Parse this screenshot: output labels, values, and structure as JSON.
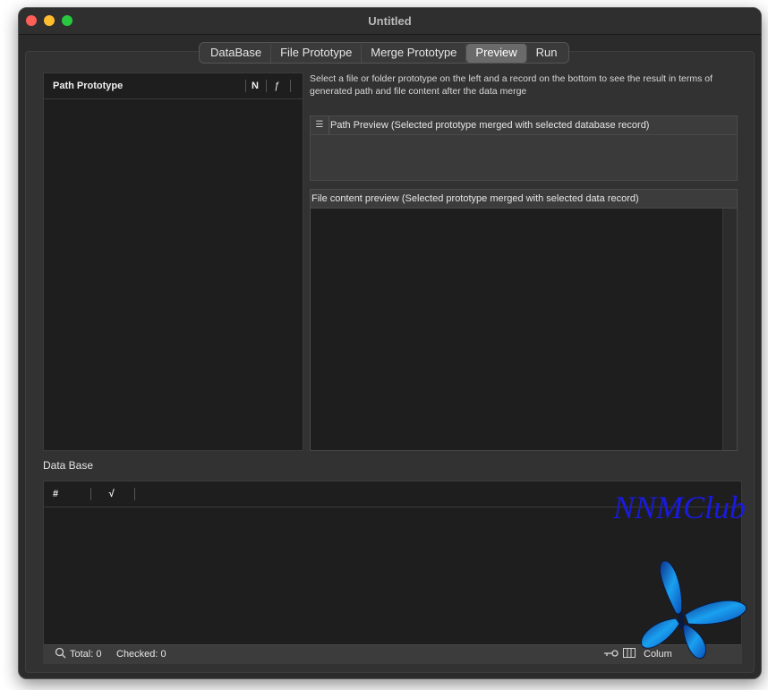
{
  "window": {
    "title": "Untitled"
  },
  "tabs": [
    {
      "label": "DataBase",
      "active": false
    },
    {
      "label": "File Prototype",
      "active": false
    },
    {
      "label": "Merge Prototype",
      "active": false
    },
    {
      "label": "Preview",
      "active": true
    },
    {
      "label": "Run",
      "active": false
    }
  ],
  "path_prototype_table": {
    "columns": [
      "Path Prototype",
      "N",
      "ƒ"
    ]
  },
  "instructions": "Select a file or folder prototype  on the left and a record on the bottom to see the result in terms of generated path and file content after the data merge",
  "path_preview": {
    "icon": "list-icon",
    "header": "Path Preview (Selected prototype merged with selected database record)"
  },
  "file_content_preview": {
    "header": "File content preview (Selected prototype merged with selected data record)"
  },
  "database": {
    "label": "Data Base",
    "columns": [
      "#",
      "√"
    ],
    "footer": {
      "search_icon": "search-icon",
      "total": "Total: 0",
      "checked": "Checked: 0",
      "key_icon": "key-icon",
      "columns_icon": "columns-icon",
      "columns_label": "Colum"
    }
  },
  "watermark": {
    "text": "NNMClub",
    "color": "#1a1ae0"
  },
  "colors": {
    "close": "#fe5f57",
    "minimize": "#febc2e",
    "maximize": "#28c840"
  }
}
